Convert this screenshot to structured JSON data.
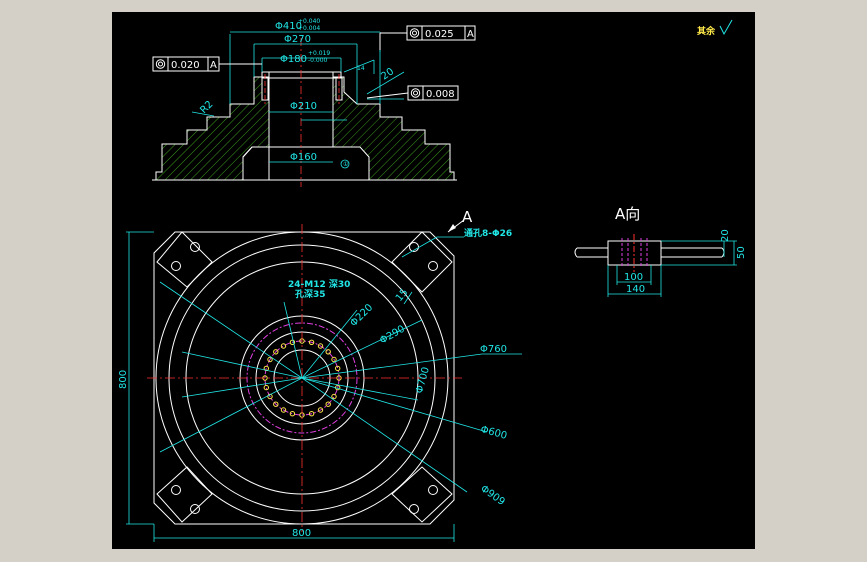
{
  "colors": {
    "background": "#000000",
    "frame": "#d4d0c8",
    "outline": "#ffffff",
    "dimension": "#21e6e6",
    "hatch": "#3c9a1e",
    "center_line": "#ff3030",
    "pitch_circle": "#e040e0",
    "holes": "#ffe94a"
  },
  "section_view": {
    "dia_410": "Φ410",
    "dia_410_tol_upper": "+0.040",
    "dia_410_tol_lower": "+0.004",
    "dia_270": "Φ270",
    "dia_180": "Φ180",
    "dia_180_tol_upper": "+0.019",
    "dia_180_tol_lower": "-0.000",
    "dia_210": "Φ210",
    "dia_160": "Φ160",
    "radius_r2": "R2",
    "dim_14": "14",
    "dim_20": "20",
    "gdt_top_value": "0.025",
    "gdt_top_datum": "A",
    "gdt_left_value": "0.020",
    "gdt_left_datum": "A",
    "gdt_right_value": "0.008",
    "datum_marker": "①"
  },
  "roughness_note": "其余",
  "top_view": {
    "view_marker": "A",
    "through_holes": "通孔8-Φ26",
    "tapped_holes_line1": "24-M12 深30",
    "tapped_holes_line2": "孔深35",
    "dim_15": "15",
    "dia_220": "Φ220",
    "dia_290": "Φ290",
    "dia_700": "Φ700",
    "dia_760": "Φ760",
    "dia_600": "Φ600",
    "dia_909": "Φ909",
    "width": "800",
    "height": "800"
  },
  "view_a": {
    "title": "A向",
    "dim_100": "100",
    "dim_140": "140",
    "dim_20": "20",
    "dim_50": "50"
  }
}
